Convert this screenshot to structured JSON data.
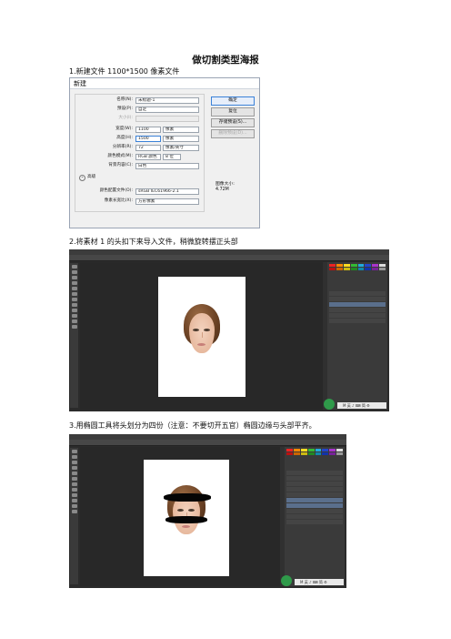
{
  "document": {
    "title": "做切割类型海报",
    "steps": [
      "1.新建文件 1100*1500 像素文件",
      "2.将素材 1 的头扣下来导入文件，稍微旋转摆正头部",
      "3.用椭圆工具将头划分为四份（注意：不要切开五官）椭圆边缘与头部平齐。"
    ]
  },
  "new_dialog": {
    "title": "新建",
    "rows": [
      {
        "label": "名称(N):",
        "value": "未标题-1"
      },
      {
        "label": "预设(P):",
        "value": "自定"
      },
      {
        "label": "大小(I):",
        "value": ""
      },
      {
        "label": "宽度(W):",
        "value": "1100",
        "unit": "像素"
      },
      {
        "label": "高度(H):",
        "value": "1500",
        "unit": "像素"
      },
      {
        "label": "分辨率(R):",
        "value": "72",
        "unit": "像素/英寸"
      },
      {
        "label": "颜色模式(M):",
        "value": "RGB 颜色",
        "unit": "8 位"
      },
      {
        "label": "背景内容(C):",
        "value": "白色"
      }
    ],
    "advanced_label": "高级",
    "advanced_rows": [
      {
        "label": "颜色配置文件(O):",
        "value": "sRGB IEC61966-2.1"
      },
      {
        "label": "像素长宽比(X):",
        "value": "方形像素"
      }
    ],
    "buttons": {
      "ok": "确定",
      "reset": "复位",
      "save_preset": "存储预设(S)...",
      "delete_preset": "删除预设(D)..."
    },
    "image_size_label": "图像大小:",
    "image_size_value": "4.72M"
  },
  "ps": {
    "taskbar_text": "M 英 ♪ ⌨ 简 ⚙"
  },
  "colors": {
    "ps_bg": "#2b2b2b",
    "ok_border": "#3b82d8",
    "black_band": "#050505"
  }
}
